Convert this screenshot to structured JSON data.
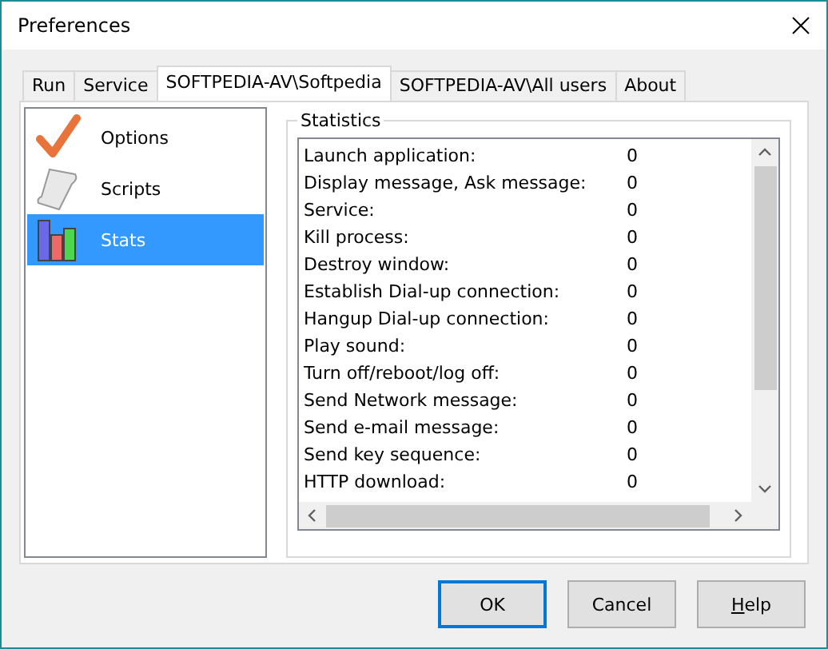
{
  "window": {
    "title": "Preferences"
  },
  "tabs": [
    {
      "label": "Run",
      "selected": false
    },
    {
      "label": "Service",
      "selected": false
    },
    {
      "label": "SOFTPEDIA-AV\\Softpedia",
      "selected": true
    },
    {
      "label": "SOFTPEDIA-AV\\All users",
      "selected": false
    },
    {
      "label": "About",
      "selected": false
    }
  ],
  "sidebar": {
    "items": [
      {
        "label": "Options",
        "kind": "check",
        "selected": false
      },
      {
        "label": "Scripts",
        "kind": "scroll",
        "selected": false
      },
      {
        "label": "Stats",
        "kind": "chart",
        "selected": true
      }
    ]
  },
  "statistics": {
    "title": "Statistics",
    "rows": [
      {
        "name": "Launch application:",
        "value": "0"
      },
      {
        "name": "Display message, Ask message:",
        "value": "0"
      },
      {
        "name": "Service:",
        "value": "0"
      },
      {
        "name": "Kill process:",
        "value": "0"
      },
      {
        "name": "Destroy window:",
        "value": "0"
      },
      {
        "name": "Establish Dial-up connection:",
        "value": "0"
      },
      {
        "name": "Hangup Dial-up connection:",
        "value": "0"
      },
      {
        "name": "Play sound:",
        "value": "0"
      },
      {
        "name": "Turn off/reboot/log off:",
        "value": "0"
      },
      {
        "name": "Send Network message:",
        "value": "0"
      },
      {
        "name": "Send e-mail message:",
        "value": "0"
      },
      {
        "name": "Send key sequence:",
        "value": "0"
      },
      {
        "name": "HTTP download:",
        "value": "0"
      }
    ]
  },
  "buttons": [
    {
      "label": "OK",
      "default": true
    },
    {
      "label": "Cancel",
      "default": false
    },
    {
      "label": "Help",
      "default": false,
      "underline_first": true
    }
  ]
}
